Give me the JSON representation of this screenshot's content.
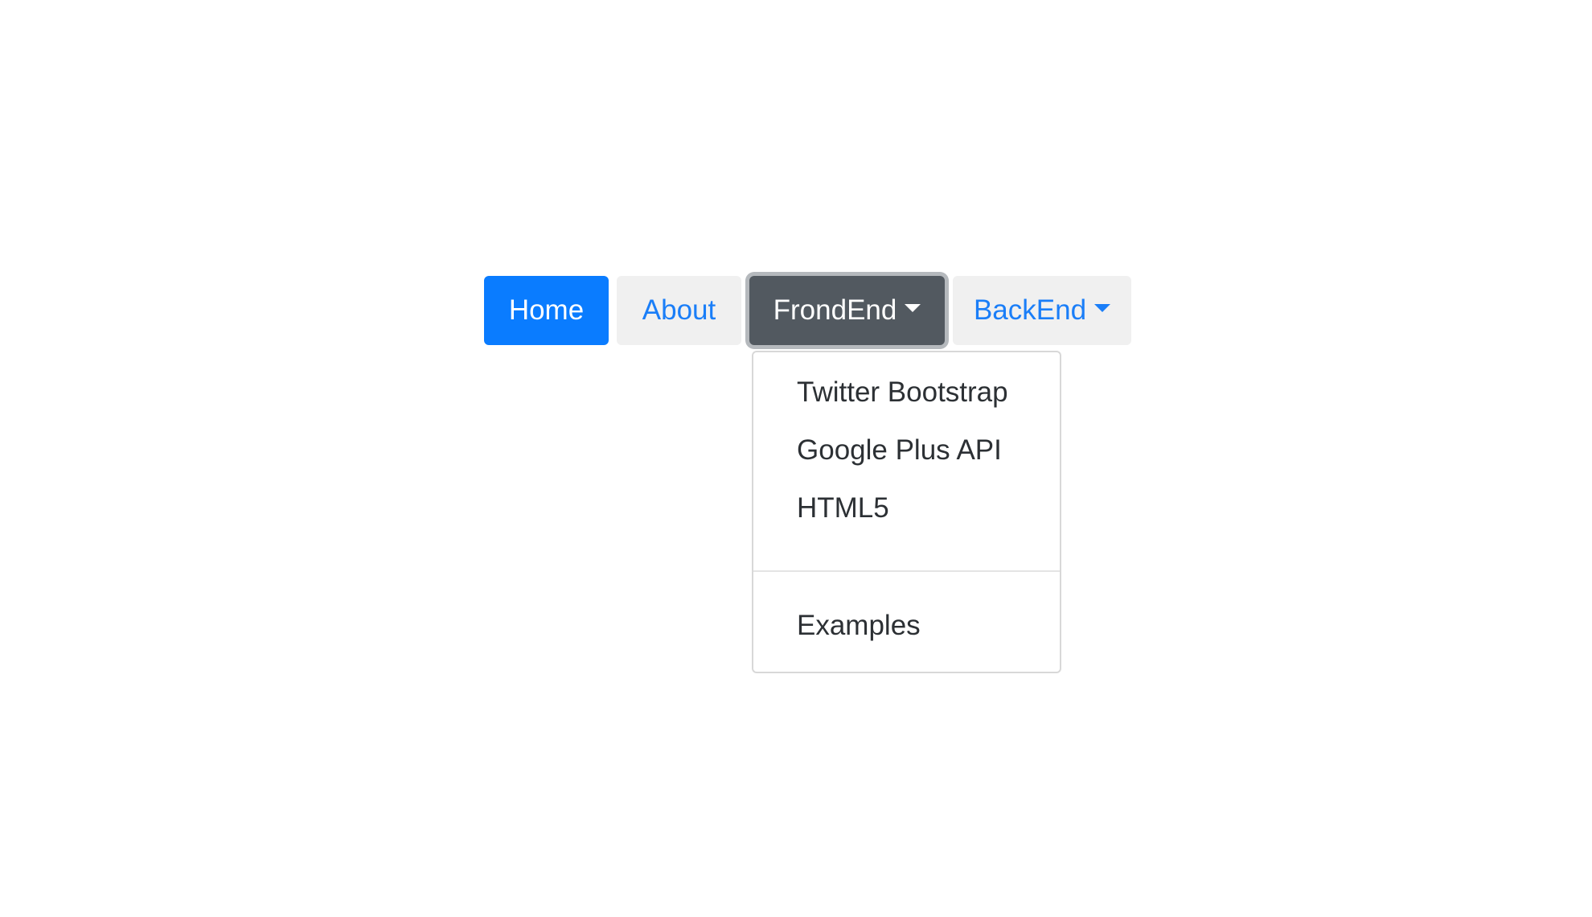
{
  "colors": {
    "primary": "#0a7cff",
    "link": "#1a7ef8",
    "dark": "#525960"
  },
  "nav": {
    "home_label": "Home",
    "about_label": "About",
    "frontend_label": "FrondEnd",
    "backend_label": "BackEnd",
    "active_item": "Home",
    "open_dropdown": "FrondEnd"
  },
  "dropdown": {
    "items": [
      {
        "label": "Twitter Bootstrap"
      },
      {
        "label": "Google Plus API"
      },
      {
        "label": "HTML5"
      },
      {
        "label": "Examples"
      }
    ]
  },
  "icons": {
    "frontend_caret": "caret-down-icon",
    "backend_caret": "caret-down-icon"
  }
}
